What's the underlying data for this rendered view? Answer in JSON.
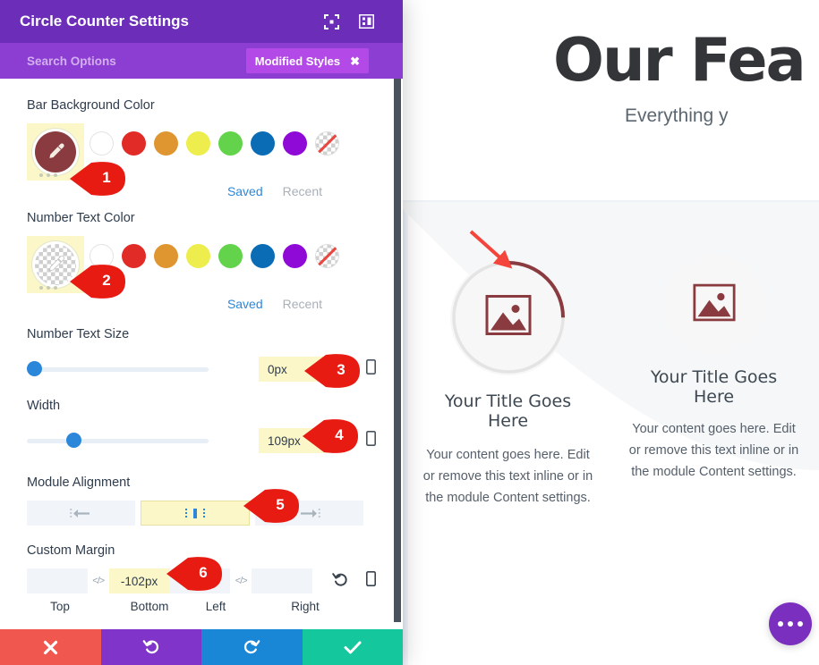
{
  "modal": {
    "title": "Circle Counter Settings",
    "header_icons": [
      {
        "name": "focus-icon"
      },
      {
        "name": "panel-layout-icon"
      }
    ],
    "search": {
      "placeholder": "Search Options",
      "value": ""
    },
    "modified_styles": {
      "label": "Modified Styles",
      "close": "✖"
    },
    "fields": [
      {
        "id": "bar-background-color",
        "label": "Bar Background Color",
        "type": "color",
        "active_color": "#8a3b3f",
        "active_kind": "solid",
        "tabs": {
          "saved": "Saved",
          "recent": "Recent"
        }
      },
      {
        "id": "number-text-color",
        "label": "Number Text Color",
        "type": "color",
        "active_color": "transparent",
        "active_kind": "checker",
        "tabs": {
          "saved": "Saved",
          "recent": "Recent"
        }
      },
      {
        "id": "number-text-size",
        "label": "Number Text Size",
        "type": "slider",
        "value": "0px",
        "percent": 2
      },
      {
        "id": "width",
        "label": "Width",
        "type": "slider",
        "value": "109px",
        "percent": 25
      },
      {
        "id": "module-alignment",
        "label": "Module Alignment",
        "type": "alignment",
        "options": [
          "align-left",
          "align-center",
          "align-right"
        ],
        "selected": "align-center"
      },
      {
        "id": "custom-margin",
        "label": "Custom Margin",
        "type": "margin",
        "inputs": [
          {
            "label": "Top",
            "value": "",
            "active": false
          },
          {
            "label": "Bottom",
            "value": "-102px",
            "active": true
          },
          {
            "label": "Left",
            "value": "",
            "active": false
          },
          {
            "label": "Right",
            "value": "",
            "active": false
          }
        ]
      }
    ],
    "palette": [
      {
        "name": "swatch-white",
        "color": "#ffffff"
      },
      {
        "name": "swatch-red",
        "color": "#e02b27"
      },
      {
        "name": "swatch-orange",
        "color": "#df9530"
      },
      {
        "name": "swatch-yellow",
        "color": "#eded4e"
      },
      {
        "name": "swatch-green",
        "color": "#62d34a"
      },
      {
        "name": "swatch-blue",
        "color": "#0a6cb4"
      },
      {
        "name": "swatch-purple",
        "color": "#8f0ad6"
      },
      {
        "name": "swatch-none",
        "color": "transparent"
      }
    ],
    "footer_buttons": [
      {
        "name": "cancel-button",
        "icon": "✖",
        "color": "#f0584f"
      },
      {
        "name": "undo-button",
        "icon": "↺",
        "color": "#8134c9"
      },
      {
        "name": "redo-button",
        "icon": "↻",
        "color": "#1a87d6"
      },
      {
        "name": "save-button",
        "icon": "✔",
        "color": "#14c79c"
      }
    ]
  },
  "callouts": [
    {
      "num": "1"
    },
    {
      "num": "2"
    },
    {
      "num": "3"
    },
    {
      "num": "4"
    },
    {
      "num": "5"
    },
    {
      "num": "6"
    }
  ],
  "preview": {
    "hero_title": "Our Fea",
    "hero_subtitle": "Everything y",
    "cards": [
      {
        "title": "Your Title Goes Here",
        "body": "Your content goes here. Edit or remove this text inline or in the module Content settings.",
        "has_progress_ring": true,
        "ring_color": "#8a3b3f",
        "ring_percent": 25
      },
      {
        "title": "Your Title Goes Here",
        "body": "Your content goes here. Edit or remove this text inline or in the module Content settings.",
        "has_progress_ring": false,
        "ring_color": "#8a3b3f",
        "ring_percent": 0
      }
    ],
    "fab": {
      "name": "more-options-fab",
      "dots": 3
    }
  }
}
